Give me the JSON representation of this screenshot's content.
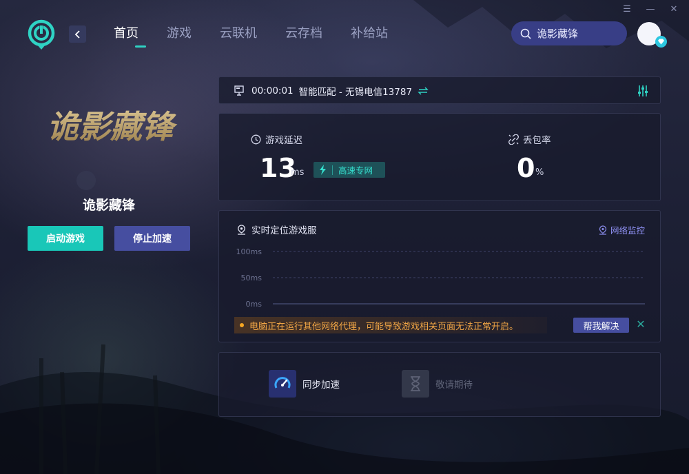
{
  "window": {
    "controls": [
      "☰",
      "—",
      "✕"
    ]
  },
  "nav": {
    "items": [
      "首页",
      "游戏",
      "云联机",
      "云存档",
      "补给站"
    ],
    "active": 0
  },
  "search": {
    "text": "诡影藏锋"
  },
  "game": {
    "logo_text": "诡影藏锋",
    "name": "诡影藏锋",
    "start_label": "启动游戏",
    "stop_label": "停止加速"
  },
  "status": {
    "timer": "00:00:01",
    "route": "智能匹配 - 无锡电信13787"
  },
  "stats": {
    "latency_label": "游戏延迟",
    "latency_value": "13",
    "latency_unit": "ms",
    "line_badge": "高速专网",
    "loss_label": "丢包率",
    "loss_value": "0",
    "loss_unit": "%"
  },
  "monitor": {
    "title": "实时定位游戏服",
    "net_monitor_label": "网络监控",
    "y_ticks": [
      "100ms",
      "50ms",
      "0ms"
    ],
    "warning": "电脑正在运行其他网络代理，可能导致游戏相关页面无法正常开启。",
    "help_label": "帮我解决"
  },
  "chart_data": {
    "type": "line",
    "ylabels": [
      "100ms",
      "50ms",
      "0ms"
    ],
    "ylim": [
      0,
      100
    ],
    "series": []
  },
  "tools": {
    "sync_label": "同步加速",
    "coming_label": "敬请期待"
  },
  "colors": {
    "accent": "#19c7b8",
    "secondary": "#464ea0",
    "warning": "#f0a545",
    "link": "#8d8ff0"
  }
}
